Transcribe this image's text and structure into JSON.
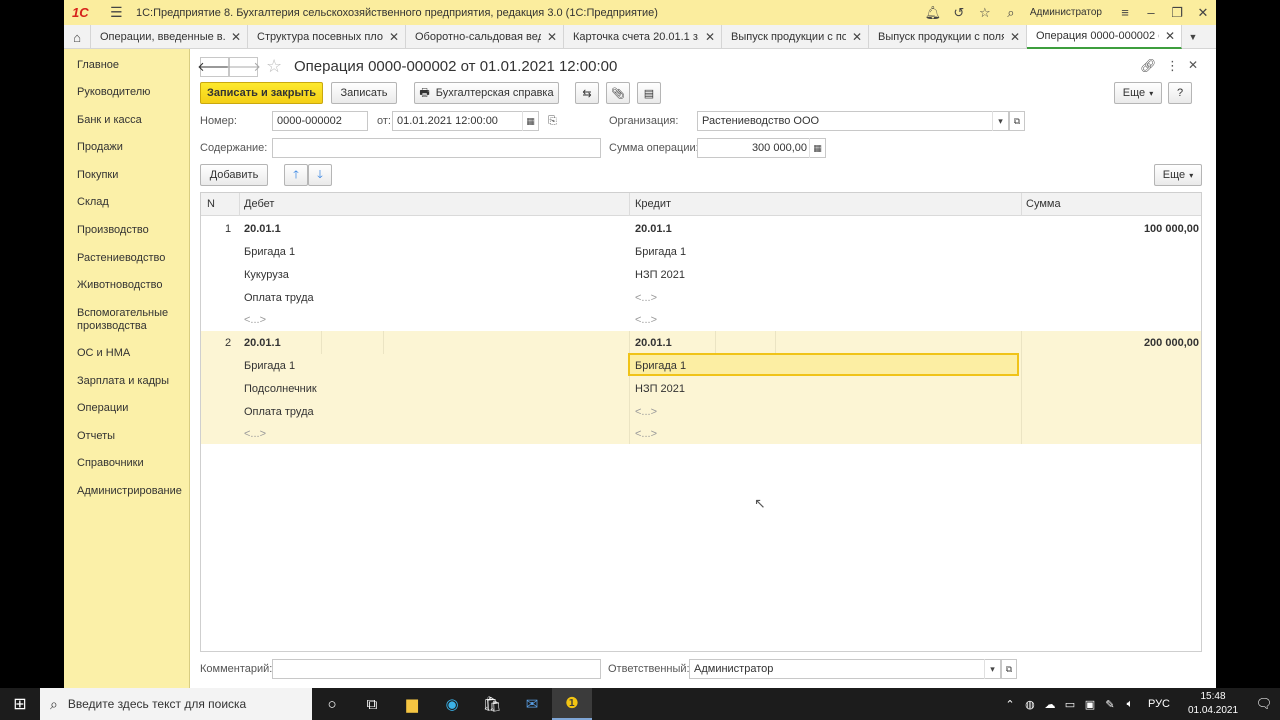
{
  "window": {
    "title": "1С:Предприятие 8. Бухгалтерия сельскохозяйственного предприятия, редакция 3.0  (1С:Предприятие)",
    "user": "Администратор"
  },
  "tabs": [
    {
      "label": "Операции, введенные в...",
      "active": false
    },
    {
      "label": "Структура посевных пло...",
      "active": false
    },
    {
      "label": "Оборотно-сальдовая вед...",
      "active": false
    },
    {
      "label": "Карточка счета 20.01.1 з...",
      "active": false
    },
    {
      "label": "Выпуск продукции с поля",
      "active": false
    },
    {
      "label": "Выпуск продукции с поля...",
      "active": false
    },
    {
      "label": "Операция 0000-000002 о...",
      "active": true
    }
  ],
  "sidebar": {
    "items": [
      "Главное",
      "Руководителю",
      "Банк и касса",
      "Продажи",
      "Покупки",
      "Склад",
      "Производство",
      "Растениеводство",
      "Животноводство",
      "Вспомогательные производства",
      "ОС и НМА",
      "Зарплата и кадры",
      "Операции",
      "Отчеты",
      "Справочники",
      "Администрирование"
    ]
  },
  "form": {
    "title": "Операция 0000-000002 от 01.01.2021 12:00:00",
    "toolbar": {
      "save_close": "Записать и закрыть",
      "save": "Записать",
      "report": "Бухгалтерская справка",
      "more": "Еще",
      "help": "?"
    },
    "fields": {
      "number_label": "Номер:",
      "number_value": "0000-000002",
      "date_label": "от:",
      "date_value": "01.01.2021 12:00:00",
      "org_label": "Организация:",
      "org_value": "Растениеводство ООО",
      "content_label": "Содержание:",
      "content_value": "",
      "sum_label": "Сумма операции:",
      "sum_value": "300 000,00"
    },
    "table_toolbar": {
      "add": "Добавить",
      "more": "Еще"
    },
    "table": {
      "headers": {
        "n": "N",
        "debit": "Дебет",
        "credit": "Кредит",
        "sum": "Сумма"
      },
      "rows": [
        {
          "n": "1",
          "debit": [
            "20.01.1",
            "Бригада 1",
            "Кукуруза",
            "Оплата труда",
            "<...>"
          ],
          "credit": [
            "20.01.1",
            "Бригада 1",
            "НЗП 2021",
            "<...>",
            "<...>"
          ],
          "sum": "100 000,00"
        },
        {
          "n": "2",
          "debit": [
            "20.01.1",
            "Бригада 1",
            "Подсолнечник",
            "Оплата труда",
            "<...>"
          ],
          "credit": [
            "20.01.1",
            "Бригада 1",
            "НЗП 2021",
            "<...>",
            "<...>"
          ],
          "sum": "200 000,00"
        }
      ]
    },
    "footer": {
      "comment_label": "Комментарий:",
      "comment_value": "",
      "responsible_label": "Ответственный:",
      "responsible_value": "Администратор"
    }
  },
  "taskbar": {
    "search_placeholder": "Введите здесь текст для поиска",
    "lang": "РУС",
    "time": "15:48",
    "date": "01.04.2021"
  },
  "colors": {
    "sidebar_bg": "#fbf0a8",
    "titlebar_bg": "#fbed9e",
    "primary_button": "#f4cf16",
    "selected_row": "#fcf5d4",
    "active_tab_accent": "#3d9e3d"
  }
}
